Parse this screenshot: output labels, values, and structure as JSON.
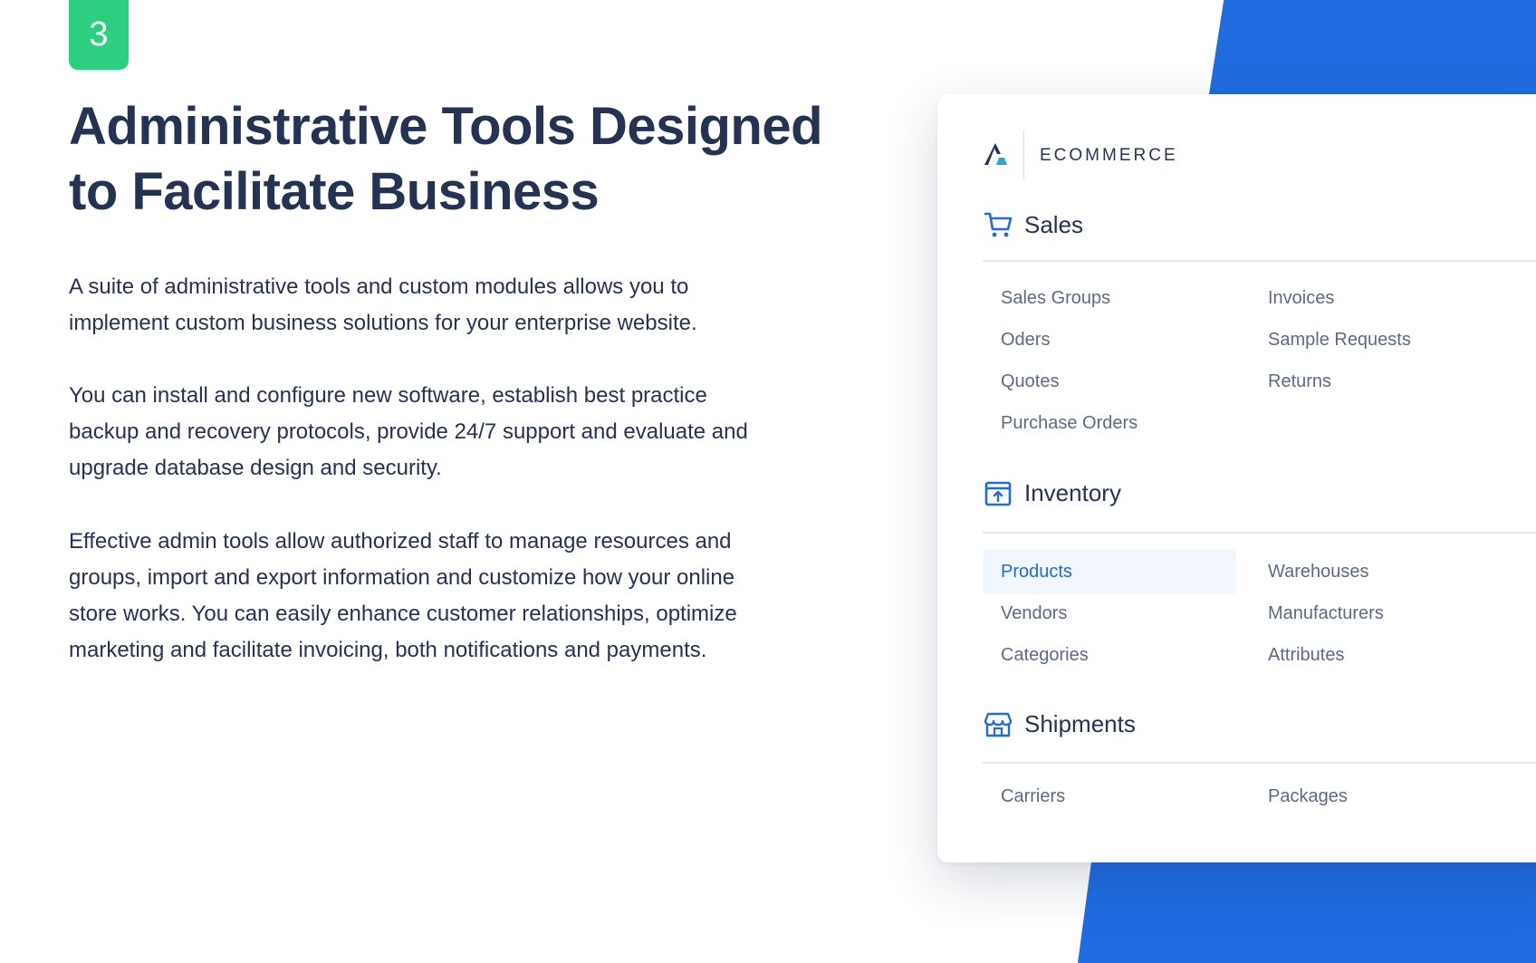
{
  "step_badge": "3",
  "headline_line1": "Administrative Tools Designed",
  "headline_line2": "to Facilitate Business",
  "paragraphs": [
    "A suite of administrative tools and custom modules allows you to implement custom business solutions for your enterprise website.",
    "You can install and configure new software, establish best practice backup and recovery protocols, provide 24/7 support and evaluate and upgrade database design and security.",
    "Effective admin tools allow authorized staff to manage resources and groups, import and export information and customize how your online store works. You can easily enhance customer relationships, optimize marketing and facilitate invoicing, both notifications and payments."
  ],
  "colors": {
    "accent_blue": "#1f6ce0",
    "badge_green": "#2ccf80",
    "heading_text": "#253353",
    "link_text": "#5c6b84",
    "active_bg": "#f2f6fd"
  },
  "panel": {
    "brand": "ECOMMERCE",
    "logo_icon": "mountain-logo-icon",
    "sections": {
      "sales": {
        "title": "Sales",
        "icon": "shopping-cart-icon",
        "items": [
          "Sales Groups",
          "Invoices",
          "Oders",
          "Sample Requests",
          "Quotes",
          "Returns",
          "Purchase Orders"
        ]
      },
      "inventory": {
        "title": "Inventory",
        "icon": "inventory-box-icon",
        "active_item": "Products",
        "items": [
          "Products",
          "Warehouses",
          "Vendors",
          "Manufacturers",
          "Categories",
          "Attributes"
        ]
      },
      "shipments": {
        "title": "Shipments",
        "icon": "storefront-icon",
        "items": [
          "Carriers",
          "Packages"
        ]
      }
    }
  }
}
